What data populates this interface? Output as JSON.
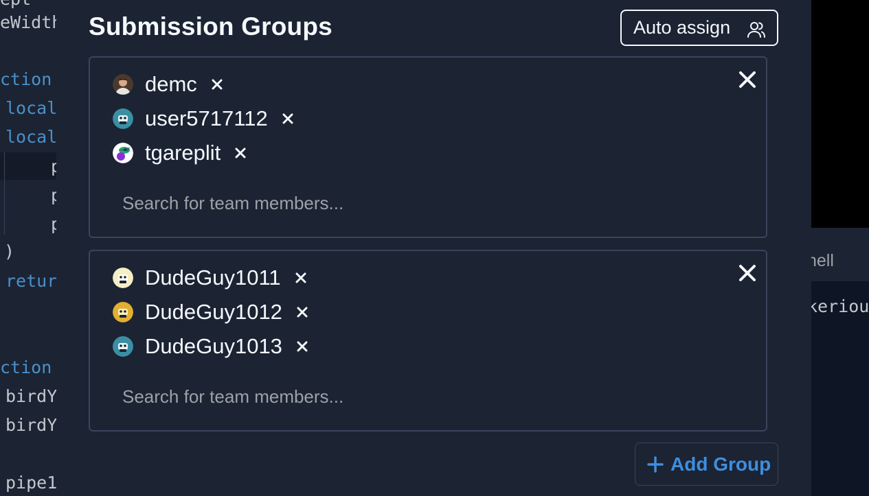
{
  "modal": {
    "title": "Submission Groups",
    "auto_assign_label": "Auto assign",
    "add_group_label": "Add Group"
  },
  "groups": [
    {
      "members": [
        {
          "name": "demc",
          "avatar": "photo-avatar"
        },
        {
          "name": "user5717112",
          "avatar": "default-robot-avatar"
        },
        {
          "name": "tgareplit",
          "avatar": "bird-avatar"
        }
      ],
      "search_placeholder": "Search for team members..."
    },
    {
      "members": [
        {
          "name": "DudeGuy1011",
          "avatar": "default-robot-avatar"
        },
        {
          "name": "DudeGuy1012",
          "avatar": "default-robot-avatar"
        },
        {
          "name": "DudeGuy1013",
          "avatar": "default-robot-avatar"
        }
      ],
      "search_placeholder": "Search for team members..."
    }
  ],
  "background": {
    "code_fragments": [
      "ept",
      "eWidth",
      "ction",
      "local",
      "local",
      "p",
      "p",
      "p",
      ")",
      "retur",
      "ction",
      "birdY",
      "birdY",
      "pipe1"
    ],
    "right_tab_fragment": "hell",
    "right_output_fragment": "keriou"
  },
  "colors": {
    "modal_bg": "#1c2333",
    "text": "#f5f9fc",
    "muted": "#9da2a6",
    "accent": "#3d8fe0",
    "border": "#3c445c"
  },
  "icons": {
    "auto_assign": "users-icon",
    "close_group": "close-icon",
    "remove_member": "close-small-icon",
    "add_group": "plus-icon"
  }
}
